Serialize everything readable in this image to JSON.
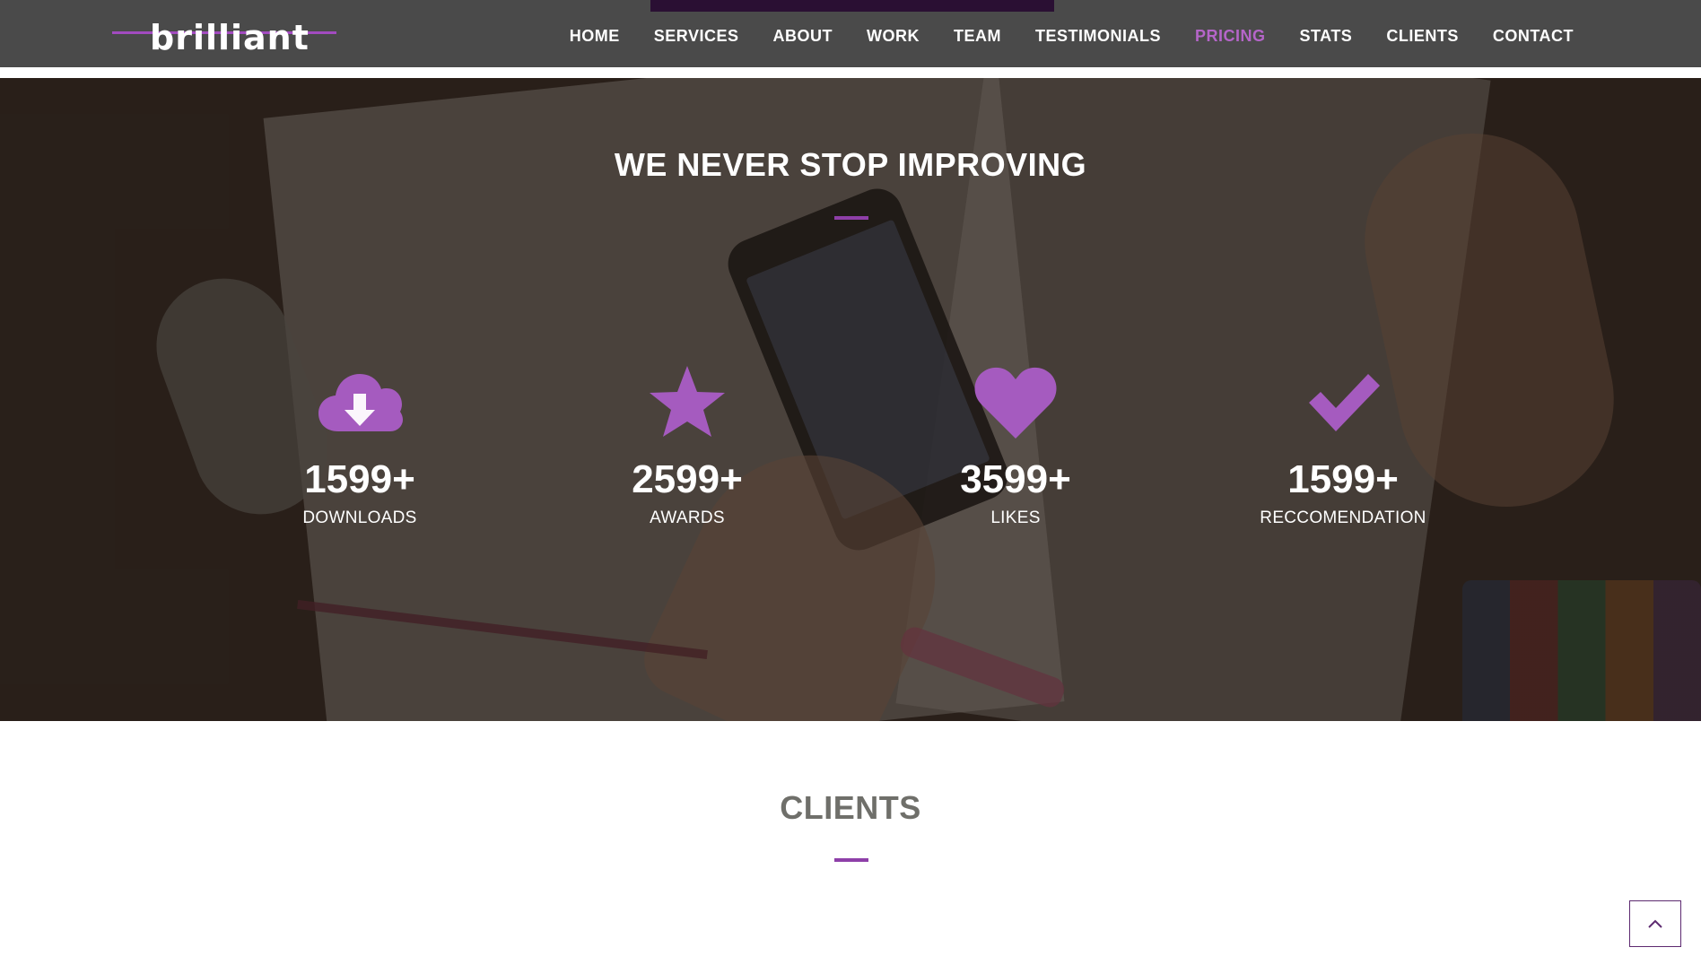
{
  "brand": {
    "name": "brilliant"
  },
  "nav": {
    "items": [
      {
        "label": "HOME"
      },
      {
        "label": "SERVICES"
      },
      {
        "label": "ABOUT"
      },
      {
        "label": "WORK"
      },
      {
        "label": "TEAM"
      },
      {
        "label": "TESTIMONIALS"
      },
      {
        "label": "PRICING",
        "active": true
      },
      {
        "label": "STATS"
      },
      {
        "label": "CLIENTS"
      },
      {
        "label": "CONTACT"
      }
    ]
  },
  "stats_section": {
    "title": "WE NEVER STOP IMPROVING",
    "items": [
      {
        "icon": "cloud-download-icon",
        "value": "1599+",
        "label": "DOWNLOADS"
      },
      {
        "icon": "star-icon",
        "value": "2599+",
        "label": "AWARDS"
      },
      {
        "icon": "heart-icon",
        "value": "3599+",
        "label": "LIKES"
      },
      {
        "icon": "check-icon",
        "value": "1599+",
        "label": "RECCOMENDATION"
      }
    ]
  },
  "clients_section": {
    "title": "CLIENTS"
  },
  "colors": {
    "accent": "#a24bbf",
    "active_nav": "#b565c9",
    "navbar_bg": "#4a4a4a",
    "divider": "#8e3fa8",
    "icon": "#a55bbf"
  },
  "back_to_top": {
    "icon": "chevron-up-icon"
  }
}
